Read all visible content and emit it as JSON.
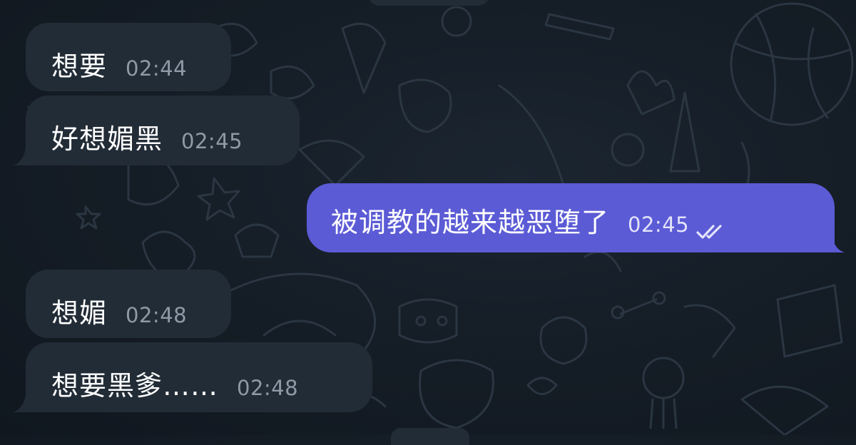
{
  "messages": [
    {
      "direction": "incoming",
      "text": "想要",
      "time": "02:44"
    },
    {
      "direction": "incoming",
      "text": "好想媚黑",
      "time": "02:45"
    },
    {
      "direction": "outgoing",
      "text": "被调教的越来越恶堕了",
      "time": "02:45",
      "status": "read"
    },
    {
      "direction": "incoming",
      "text": "想媚",
      "time": "02:48"
    },
    {
      "direction": "incoming",
      "text": "想要黑爹……",
      "time": "02:48"
    }
  ],
  "icons": {
    "read_receipt": "double-check-icon",
    "background": "doodle-pattern"
  },
  "colors": {
    "background": "#141c25",
    "incoming_bubble": "#222c37",
    "outgoing_bubble": "#5b5bd6",
    "incoming_time": "#8f9aa6",
    "outgoing_time": "#e3e3fb",
    "text": "#ffffff"
  }
}
